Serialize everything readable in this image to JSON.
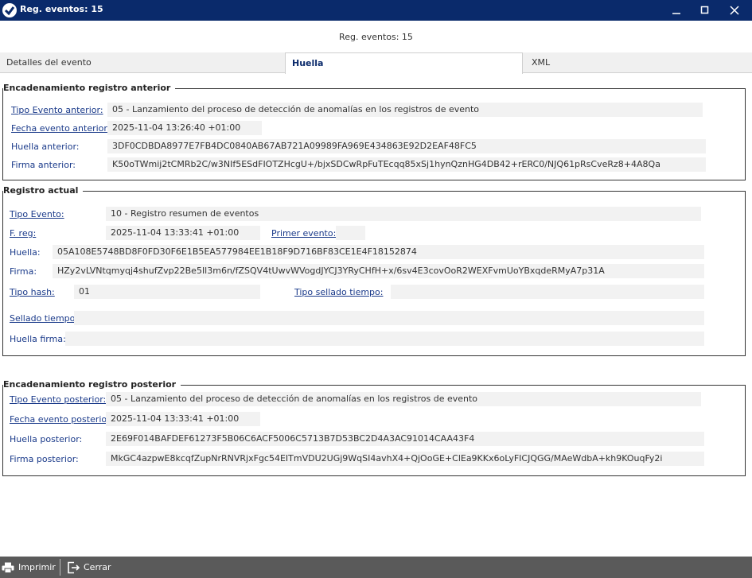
{
  "window": {
    "title": "Reg. eventos: 15"
  },
  "header": {
    "title": "Reg. eventos: 15"
  },
  "tabs": [
    "Detalles del evento",
    "Huella",
    "XML"
  ],
  "anterior": {
    "legend": "Encadenamiento registro anterior",
    "tipo_label": "Tipo Evento anterior:",
    "tipo_value": "05 - Lanzamiento del proceso de detección de anomalías en los registros de evento",
    "fecha_label": "Fecha evento anterior:",
    "fecha_value": "2025-11-04 13:26:40 +01:00",
    "huella_label": "Huella anterior:",
    "huella_value": "3DF0CDBDA8977E7FB4DC0840AB67AB721A09989FA969E434863E92D2EAF48FC5",
    "firma_label": "Firma anterior:",
    "firma_value": "K50oTWmij2tCMRb2C/w3NIf5ESdFIOTZHcgU+/bjxSDCwRpFuTEcqq85xSj1hynQznHG4DB42+rERC0/NJQ61pRsCveRz8+4A8Qa"
  },
  "actual": {
    "legend": "Registro actual",
    "tipo_label": "Tipo Evento:",
    "tipo_value": "10 - Registro resumen de eventos",
    "freg_label": "F. reg:",
    "freg_value": "2025-11-04 13:33:41 +01:00",
    "primer_label": "Primer evento:",
    "primer_value": "",
    "huella_label": "Huella:",
    "huella_value": "05A108E5748BD8F0FD30F6E1B5EA577984EE1B18F9D716BF83CE1E4F18152874",
    "firma_label": "Firma:",
    "firma_value": "HZy2vLVNtqmyqj4shufZvp22Be5Il3m6n/fZSQV4tUwvWVogdJYCJ3YRyCHfH+x/6sv4E3covOoR2WEXFvmUoYBxqdeRMyA7p31A",
    "tipohash_label": "Tipo hash:",
    "tipohash_value": "01",
    "tiposellado_label": "Tipo sellado tiempo:",
    "tiposellado_value": "",
    "sellado_label": "Sellado tiempo",
    "sellado_value": "",
    "huellafirma_label": "Huella firma:",
    "huellafirma_value": ""
  },
  "posterior": {
    "legend": "Encadenamiento registro posterior",
    "tipo_label": "Tipo Evento posterior:",
    "tipo_value": "05 - Lanzamiento del proceso de detección de anomalías en los registros de evento",
    "fecha_label": "Fecha evento posterior",
    "fecha_value": "2025-11-04 13:33:41 +01:00",
    "huella_label": "Huella posterior:",
    "huella_value": "2E69F014BAFDEF61273F5B06C6ACF5006C5713B7D53BC2D4A3AC91014CAA43F4",
    "firma_label": "Firma posterior:",
    "firma_value": "MkGC4azpwE8kcqfZupNrRNVRjxFgc54EITmVDU2UGj9WqSI4avhX4+QjOoGE+ClEa9KKx6oLyFICJQGG/MAeWdbA+kh9KOuqFy2i"
  },
  "bottombar": {
    "print_label": "Imprimir",
    "close_label": "Cerrar"
  },
  "colors": {
    "titlebar": "#0a2a6b",
    "link": "#1a3a8a",
    "bottombar": "#5a5a5a"
  }
}
